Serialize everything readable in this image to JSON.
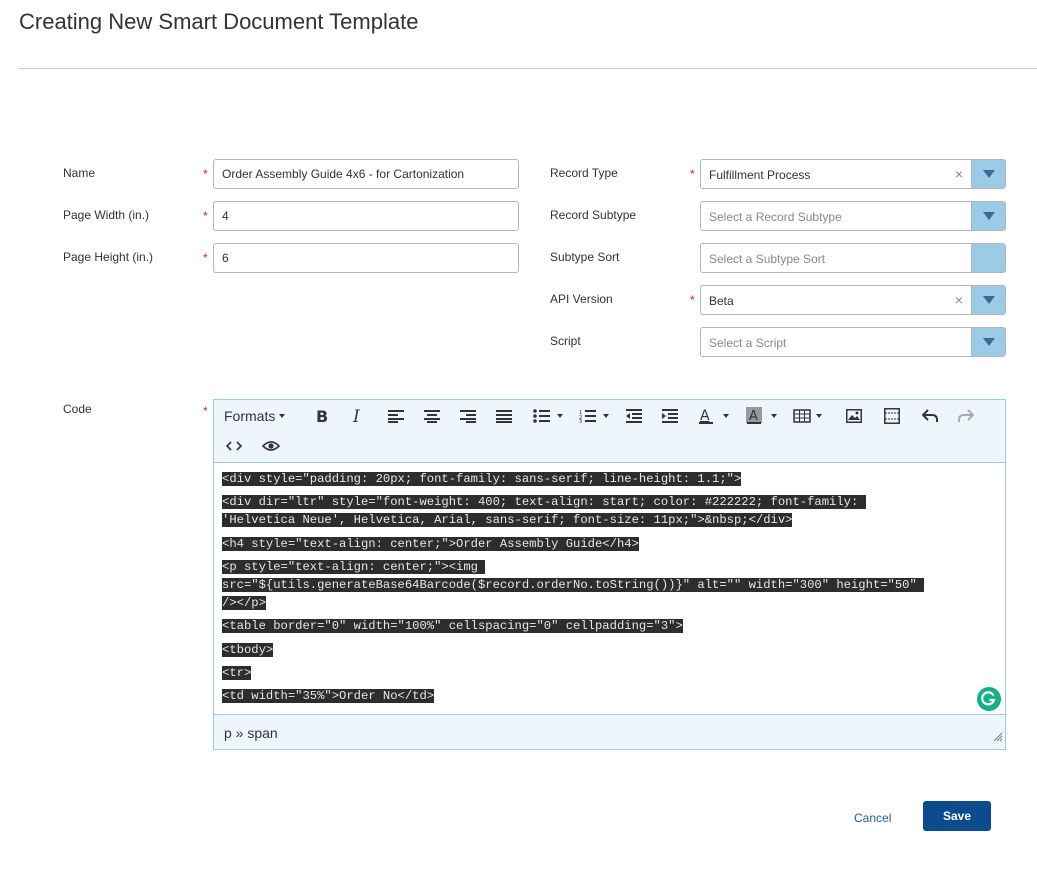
{
  "page": {
    "title": "Creating New Smart Document Template"
  },
  "form": {
    "name": {
      "label": "Name",
      "required_mark": "*",
      "value": "Order Assembly Guide 4x6 - for Cartonization"
    },
    "page_width": {
      "label": "Page Width (in.)",
      "required_mark": "*",
      "value": "4"
    },
    "page_height": {
      "label": "Page Height (in.)",
      "value": "6",
      "required_mark": "*"
    },
    "record_type": {
      "label": "Record Type",
      "required_mark": "*",
      "value": "Fulfillment Process",
      "clear": "×"
    },
    "record_subtype": {
      "label": "Record Subtype",
      "placeholder": "Select a Record Subtype"
    },
    "subtype_sort": {
      "label": "Subtype Sort",
      "placeholder": "Select a Subtype Sort"
    },
    "api_version": {
      "label": "API Version",
      "required_mark": "*",
      "value": "Beta",
      "clear": "×"
    },
    "script": {
      "label": "Script",
      "placeholder": "Select a Script"
    },
    "code": {
      "label": "Code",
      "required_mark": "*"
    }
  },
  "editor": {
    "toolbar": {
      "formats_label": "Formats",
      "icons": [
        "bold-icon",
        "italic-icon",
        "align-left-icon",
        "align-center-icon",
        "align-right-icon",
        "align-justify-icon",
        "bullet-list-icon",
        "numbered-list-icon",
        "outdent-icon",
        "indent-icon",
        "text-color-icon",
        "background-color-icon",
        "table-icon",
        "image-icon",
        "media-icon",
        "undo-icon",
        "redo-icon",
        "source-code-icon",
        "preview-icon"
      ]
    },
    "code_lines": [
      "<div style=\"padding: 20px; font-family: sans-serif; line-height: 1.1;\">",
      "<div dir=\"ltr\" style=\"font-weight: 400; text-align: start; color: #222222; font-family: ",
      "'Helvetica Neue', Helvetica, Arial, sans-serif; font-size: 11px;\">&nbsp;</div>",
      "<h4 style=\"text-align: center;\">Order Assembly Guide</h4>",
      "<p style=\"text-align: center;\"><img ",
      "src=\"${utils.generateBase64Barcode($record.orderNo.toString())}\" alt=\"\" width=\"300\" height=\"50\" ",
      "/></p>",
      "<table border=\"0\" width=\"100%\" cellspacing=\"0\" cellpadding=\"3\">",
      "<tbody>",
      "<tr>",
      "<td width=\"35%\">Order No</td>"
    ],
    "status_path": "p » span"
  },
  "actions": {
    "cancel": "Cancel",
    "save": "Save"
  },
  "colors": {
    "accent": "#0c4b8e",
    "select_arrow_bg": "#9ccbe8",
    "required": "#e02020",
    "toolbar_bg": "#eef5fc",
    "grammarly": "#15b08a"
  }
}
